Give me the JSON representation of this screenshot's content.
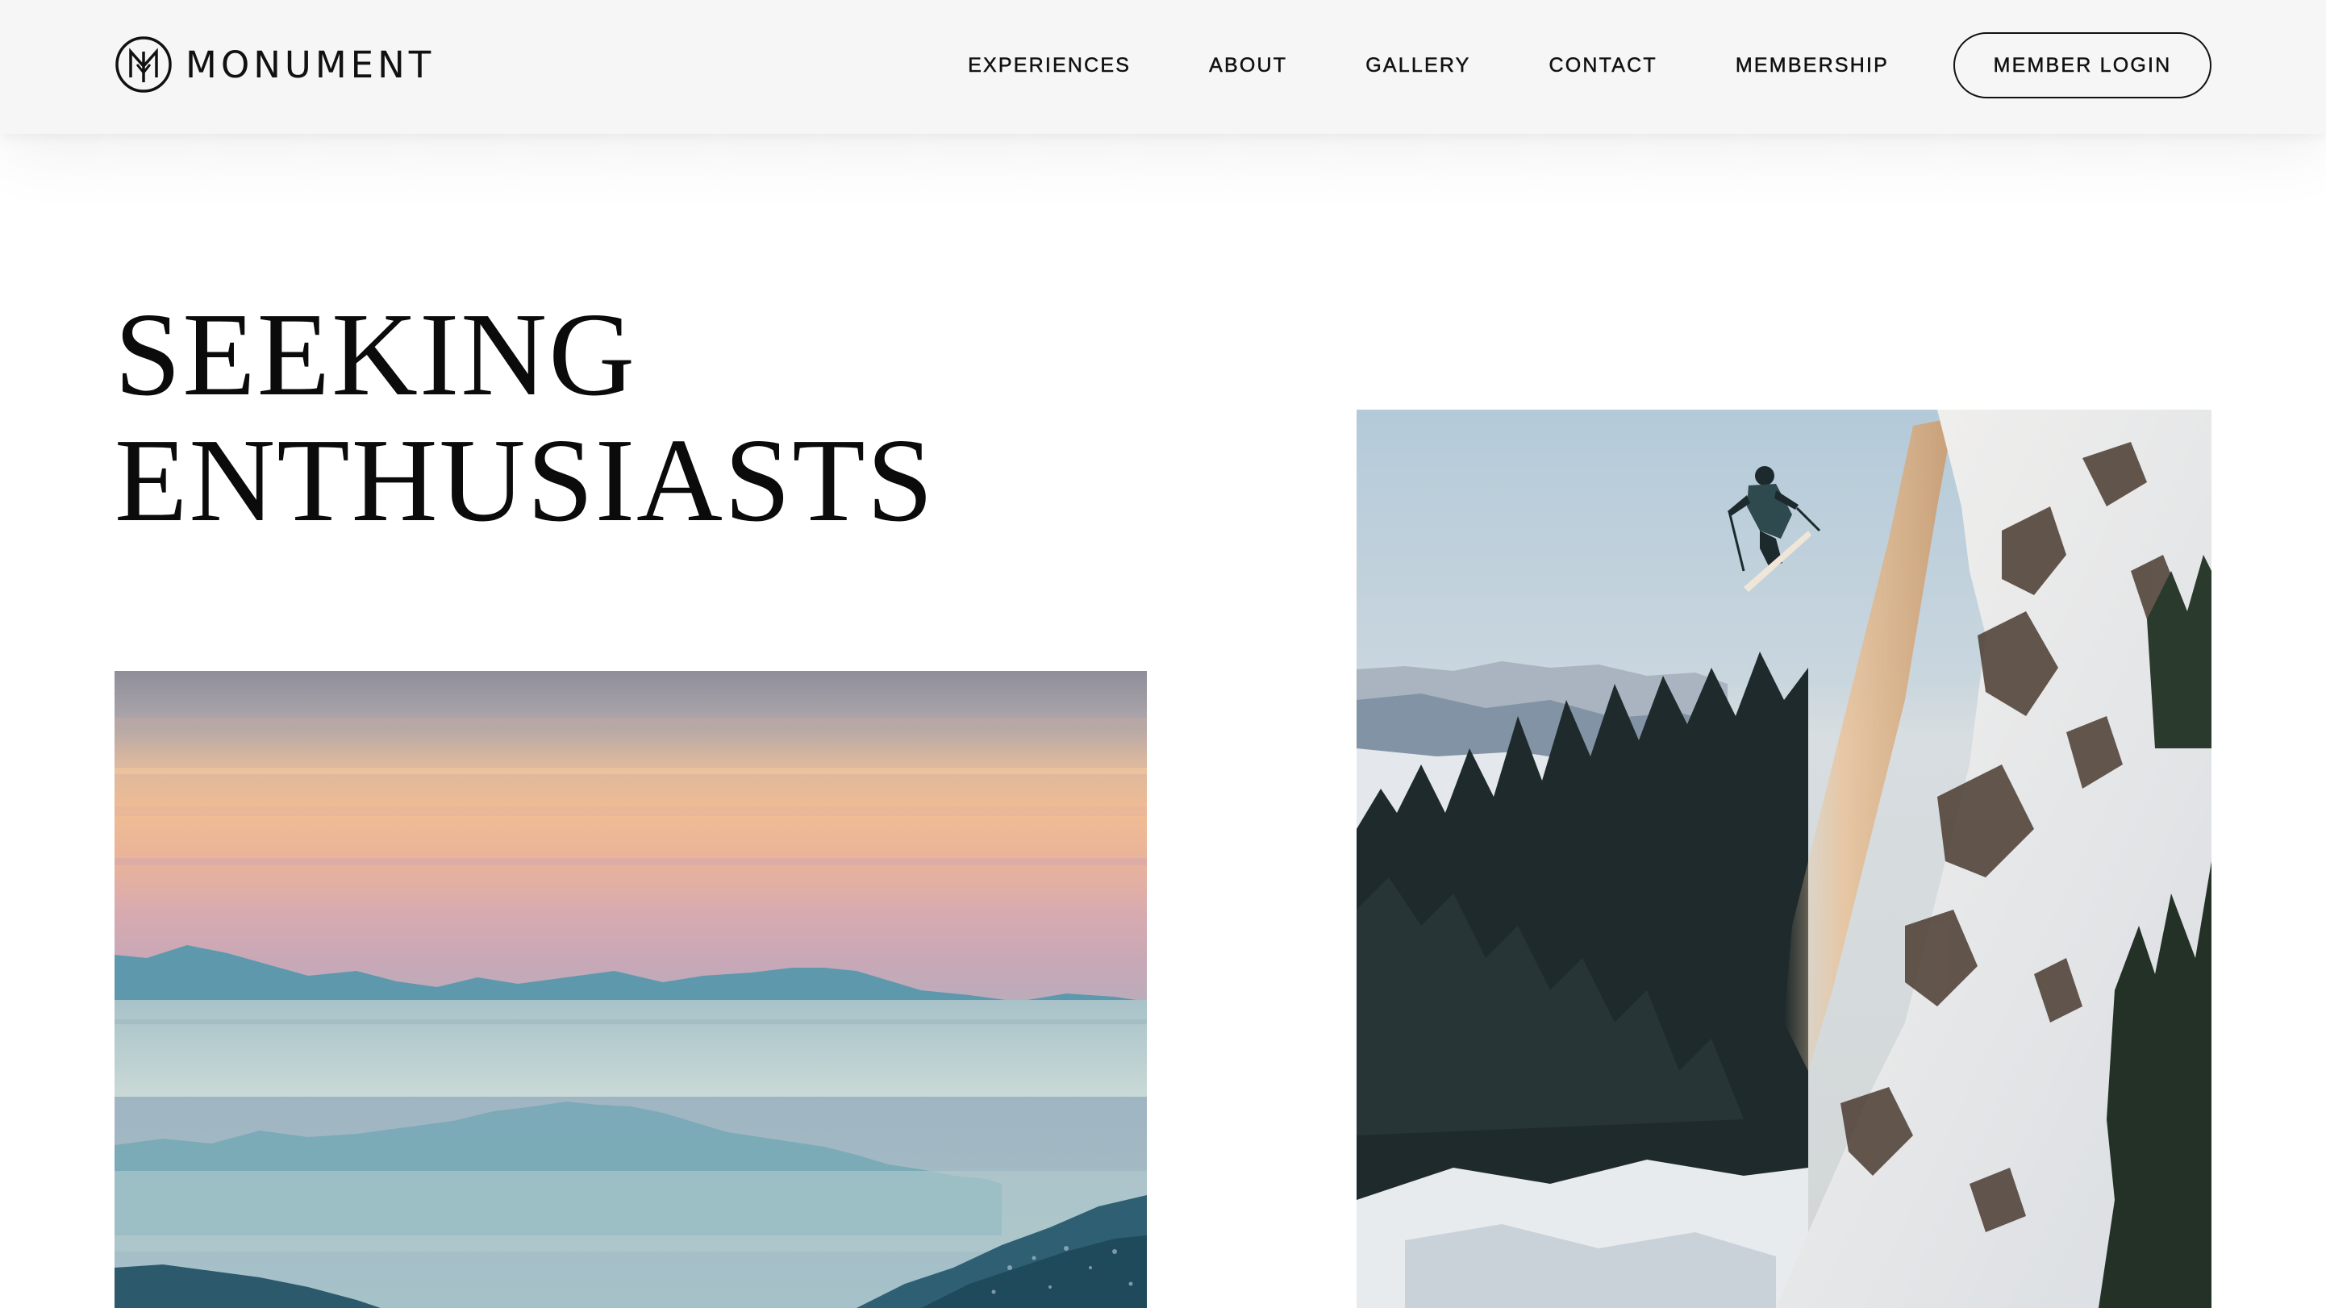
{
  "brand": {
    "name": "MONUMENT",
    "logo_icon": "monument-monogram-icon"
  },
  "nav": {
    "items": [
      {
        "label": "EXPERIENCES"
      },
      {
        "label": "ABOUT"
      },
      {
        "label": "GALLERY"
      },
      {
        "label": "CONTACT"
      },
      {
        "label": "MEMBERSHIP"
      }
    ],
    "login_label": "MEMBER LOGIN"
  },
  "hero": {
    "heading_line1": "SEEKING",
    "heading_line2": "ENTHUSIASTS"
  },
  "images": {
    "left": "sunset-mountain-ranges-above-inversion",
    "right": "skier-jumping-off-snowy-cliff"
  },
  "colors": {
    "header_bg": "#f6f6f6",
    "text": "#111111",
    "page_bg": "#ffffff"
  }
}
